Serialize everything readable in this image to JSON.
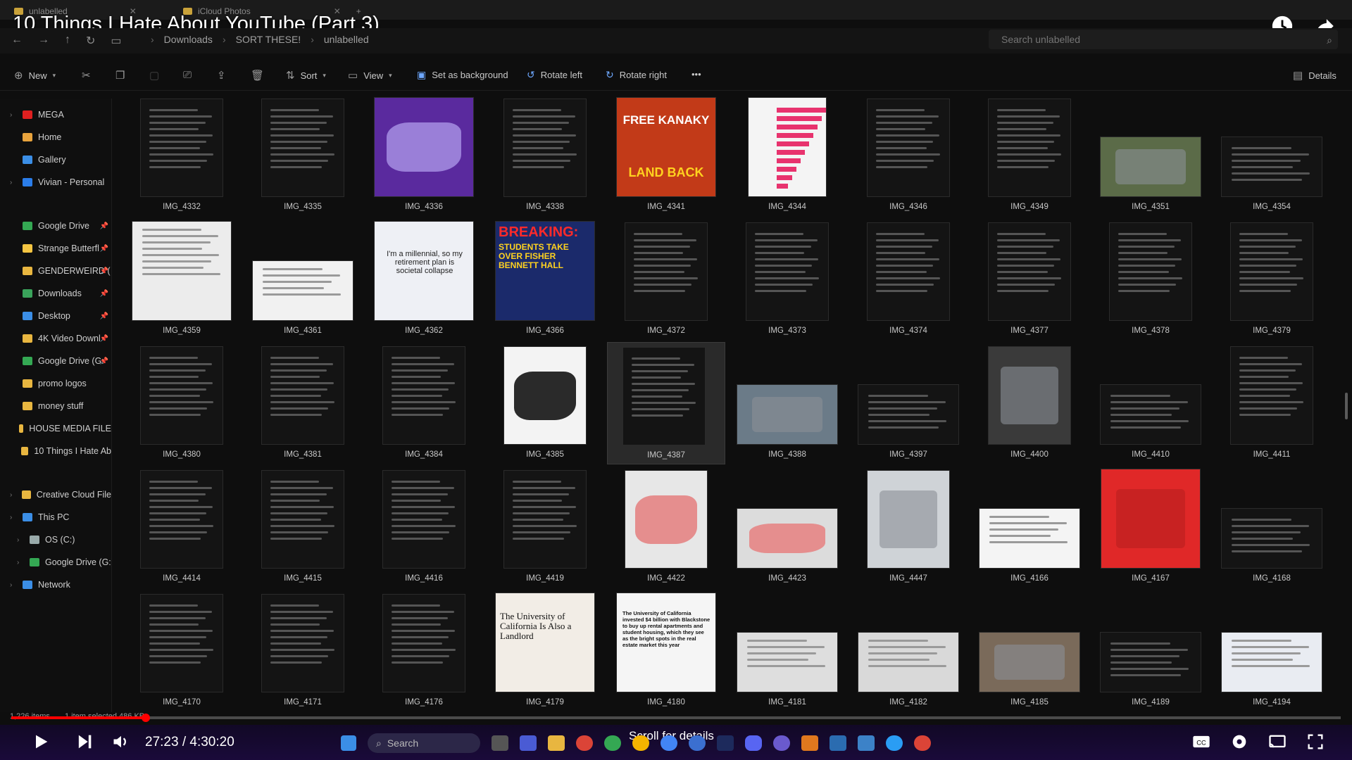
{
  "video": {
    "title": "10 Things I Hate About YouTube (Part 3)",
    "time": "27:23 / 4:30:20",
    "progress_fraction": 0.101,
    "scroll_hint": "Scroll for details"
  },
  "tabs": [
    {
      "label": "unlabelled"
    },
    {
      "label": "iCloud Photos"
    }
  ],
  "address": {
    "crumbs": [
      "Downloads",
      "SORT THESE!",
      "unlabelled"
    ],
    "search_placeholder": "Search unlabelled"
  },
  "command_bar": {
    "new": "New",
    "sort": "Sort",
    "view": "View",
    "set_background": "Set as background",
    "rotate_left": "Rotate left",
    "rotate_right": "Rotate right",
    "more": "•••",
    "details": "Details"
  },
  "sidebar": [
    {
      "label": "MEGA",
      "color": "#e02020",
      "chev": true
    },
    {
      "label": "Home",
      "color": "#e8a33d"
    },
    {
      "label": "Gallery",
      "color": "#3b8ee6"
    },
    {
      "label": "Vivian - Personal",
      "color": "#2b7de9",
      "chev": true
    },
    {
      "label": "Google Drive",
      "color": "#34a853",
      "pin": true
    },
    {
      "label": "Strange Butterfl",
      "color": "#f4c542",
      "pin": true
    },
    {
      "label": "GENDERWEIRD (",
      "color": "#e8b640",
      "pin": true
    },
    {
      "label": "Downloads",
      "color": "#3aa35b",
      "pin": true
    },
    {
      "label": "Desktop",
      "color": "#3b8ee6",
      "pin": true
    },
    {
      "label": "4K Video Downl",
      "color": "#e8b640",
      "pin": true
    },
    {
      "label": "Google Drive (G:",
      "color": "#34a853",
      "pin": true
    },
    {
      "label": "promo logos",
      "color": "#e8b640"
    },
    {
      "label": "money stuff",
      "color": "#e8b640"
    },
    {
      "label": "HOUSE MEDIA FILE",
      "color": "#e8b640"
    },
    {
      "label": "10 Things I Hate Ab",
      "color": "#e8b640"
    },
    {
      "label": "Creative Cloud File",
      "color": "#e8b640",
      "chev": true
    },
    {
      "label": "This PC",
      "color": "#3b8ee6",
      "chev": true
    },
    {
      "label": "OS (C:)",
      "color": "#9aa",
      "chev": true,
      "indent": true
    },
    {
      "label": "Google Drive (G:)",
      "color": "#34a853",
      "chev": true,
      "indent": true
    },
    {
      "label": "Network",
      "color": "#3b8ee6",
      "chev": true
    }
  ],
  "files": [
    [
      "IMG_4332",
      "IMG_4335",
      "IMG_4336",
      "IMG_4338",
      "IMG_4341",
      "IMG_4344",
      "IMG_4346",
      "IMG_4349",
      "IMG_4351",
      "IMG_4354"
    ],
    [
      "IMG_4359",
      "IMG_4361",
      "IMG_4362",
      "IMG_4366",
      "IMG_4372",
      "IMG_4373",
      "IMG_4374",
      "IMG_4377",
      "IMG_4378",
      "IMG_4379"
    ],
    [
      "IMG_4380",
      "IMG_4381",
      "IMG_4384",
      "IMG_4385",
      "IMG_4387",
      "IMG_4388",
      "IMG_4397",
      "IMG_4400",
      "IMG_4410",
      "IMG_4411"
    ],
    [
      "IMG_4414",
      "IMG_4415",
      "IMG_4416",
      "IMG_4419",
      "IMG_4422",
      "IMG_4423",
      "IMG_4447",
      "IMG_4166",
      "IMG_4167",
      "IMG_4168"
    ],
    [
      "IMG_4170",
      "IMG_4171",
      "IMG_4176",
      "IMG_4179",
      "IMG_4180",
      "IMG_4181",
      "IMG_4182",
      "IMG_4185",
      "IMG_4189",
      "IMG_4194"
    ]
  ],
  "thumb_texts": {
    "free_kanaky_1": "FREE KANAKY",
    "free_kanaky_2": "LAND BACK",
    "breaking_1": "BREAKING:",
    "breaking_2": "STUDENTS TAKE OVER FISHER BENNETT HALL",
    "millennial": "I'm a millennial, so my retirement plan is societal collapse",
    "uc_landlord": "The University of California Is Also a Landlord",
    "uc_blackstone": "The University of California invested $4 billion with Blackstone to buy up rental apartments and student housing, which they see as the bright spots in the real estate market this year"
  },
  "status": {
    "items": "1,226 items",
    "selected": "1 item selected  486 KB"
  }
}
